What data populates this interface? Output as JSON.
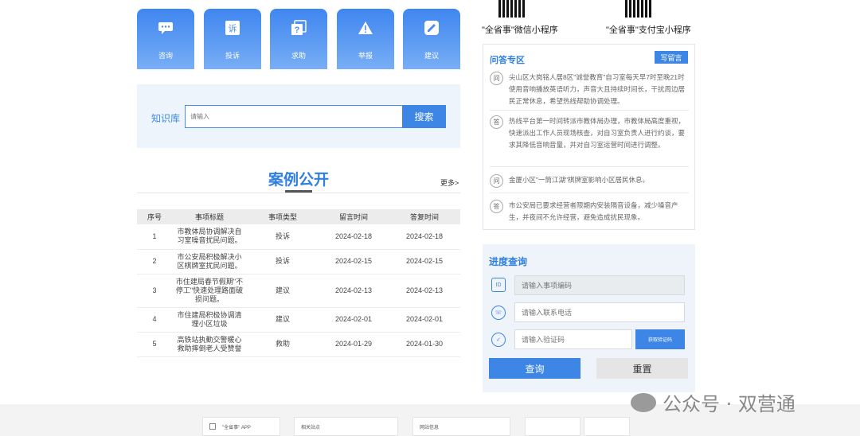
{
  "services": [
    {
      "label": "咨询",
      "icon": "chat-icon"
    },
    {
      "label": "投诉",
      "icon": "complaint-icon"
    },
    {
      "label": "求助",
      "icon": "help-icon"
    },
    {
      "label": "举报",
      "icon": "warning-icon"
    },
    {
      "label": "建议",
      "icon": "suggestion-icon"
    }
  ],
  "knowledge": {
    "label": "知识库",
    "placeholder": "请输入",
    "search_label": "搜索"
  },
  "cases": {
    "title": "案例公开",
    "more": "更多>",
    "headers": [
      "序号",
      "事项标题",
      "事项类型",
      "留言时间",
      "答复时间"
    ],
    "rows": [
      {
        "no": "1",
        "title": "市教体局协调解决自习室噪音扰民问题。",
        "type": "投诉",
        "date": "2024-02-18",
        "reply": "2024-02-18"
      },
      {
        "no": "2",
        "title": "市公安局积极解决小区棋牌室扰民问题。",
        "type": "投诉",
        "date": "2024-02-15",
        "reply": "2024-02-15"
      },
      {
        "no": "3",
        "title": "市住建局春节假期\"不停工\"快速处理路面破损问题。",
        "type": "建议",
        "date": "2024-02-13",
        "reply": "2024-02-13"
      },
      {
        "no": "4",
        "title": "市住建局积极协调清理小区垃圾",
        "type": "建议",
        "date": "2024-02-01",
        "reply": "2024-02-01"
      },
      {
        "no": "5",
        "title": "高铁站执勤交警暖心救助摔倒老人受赞誉",
        "type": "救助",
        "date": "2024-01-29",
        "reply": "2024-01-30"
      }
    ]
  },
  "qr": {
    "wechat": "\"全省事\"微信小程序",
    "alipay": "\"全省事\"支付宝小程序"
  },
  "qa": {
    "title": "问答专区",
    "write_label": "写留言",
    "items": [
      {
        "badge": "问",
        "text": "尖山区大岗铭人居8区\"诚誉教育\"自习室每天早7时至晚21时使用音响播放英语听力，声音大且持续时间长，干扰周边居民正常休息，希望热线帮助协调处理。"
      },
      {
        "badge": "答",
        "text": "热线平台第一时间转派市教体局办理，市教体局高度重视，快速派出工作人员现场核查，对自习室负责人进行约谈，要求其降低音响音量，并对自习室运营时间进行调整。"
      },
      {
        "badge": "问",
        "text": "金厦小区\"一筒江湖\"棋牌室影响小区居民休息。"
      },
      {
        "badge": "答",
        "text": "市公安局已要求经营者限期内安装隔音设备，减少噪音产生，并夜间不允许经营，避免造成扰民现象。"
      }
    ]
  },
  "progress": {
    "title": "进度查询",
    "id_placeholder": "请输入事项编码",
    "phone_placeholder": "请输入联系电话",
    "code_placeholder": "请输入验证码",
    "code_btn": "获取验证码",
    "query_label": "查询",
    "reset_label": "重置"
  },
  "footer": {
    "app": "\"全省事\" APP",
    "links": "相关站点",
    "info": "网站信息"
  },
  "watermark": "公众号 · 双营通"
}
